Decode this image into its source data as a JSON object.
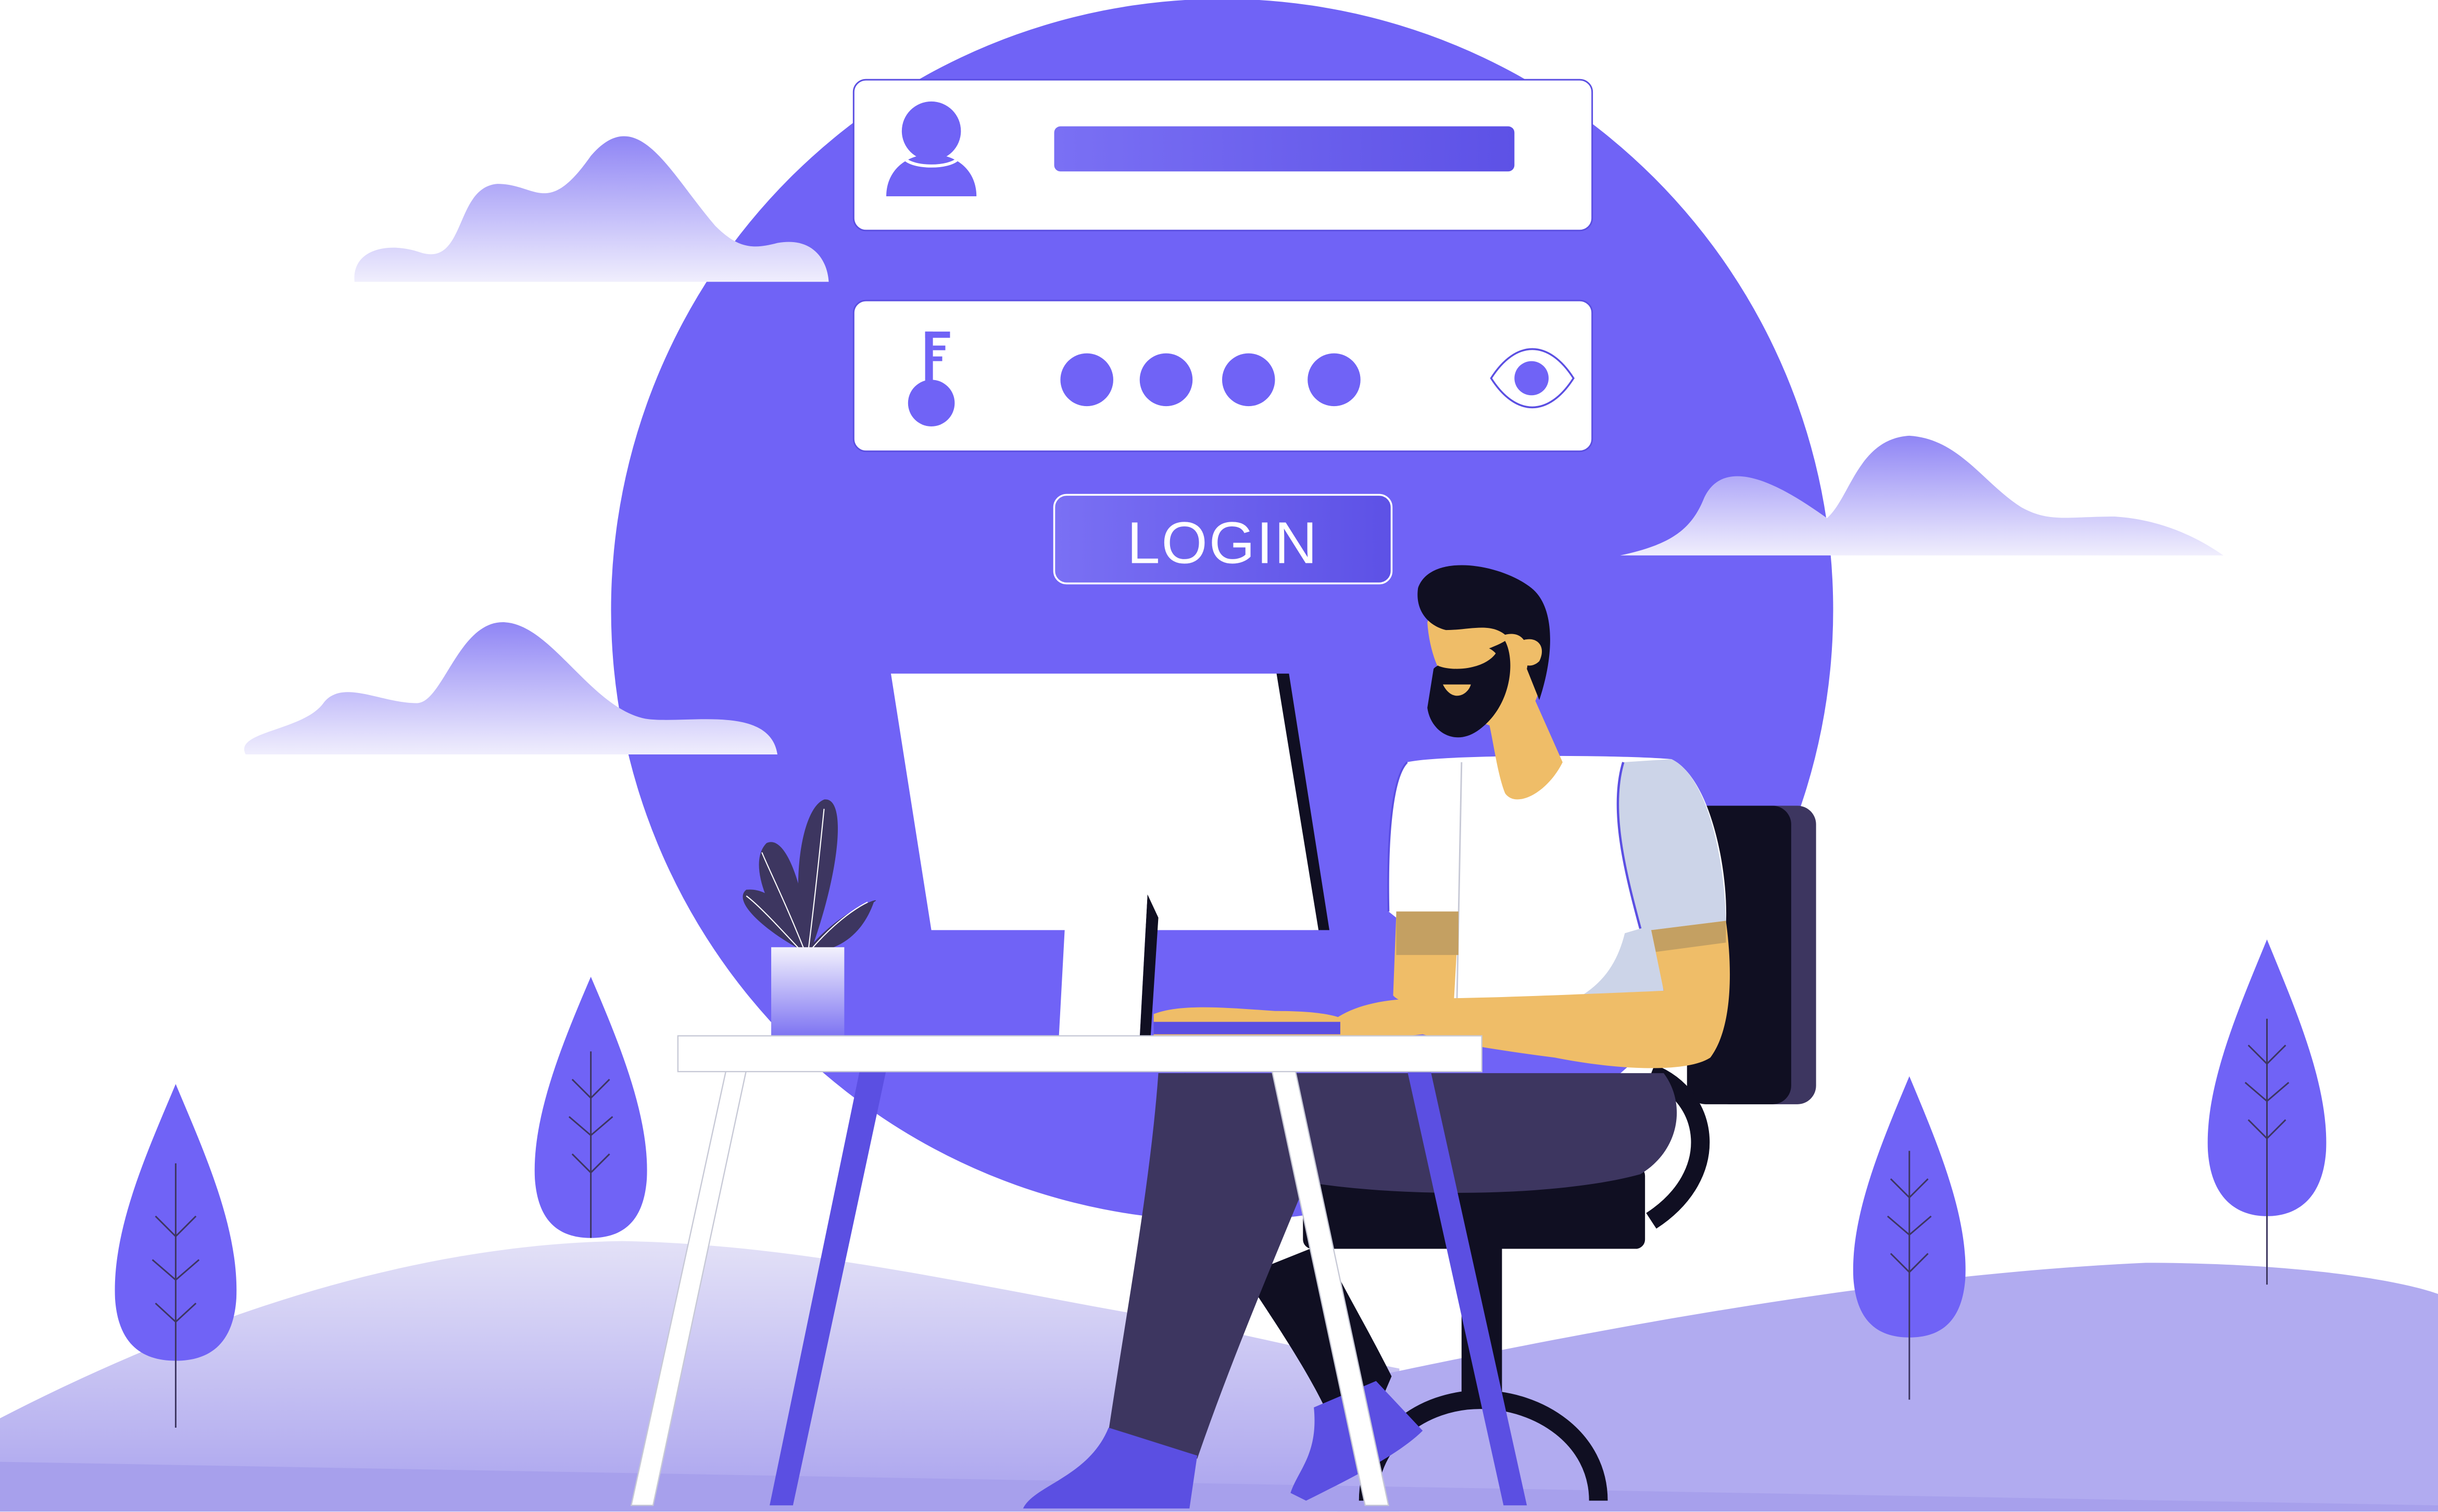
{
  "login_button": {
    "label": "LOGIN"
  },
  "password_field": {
    "masked_dot_count": 4
  },
  "colors": {
    "primary": "#7063f6",
    "primary_dark": "#5b4fe2",
    "primary_light": "#b3aef0",
    "dark_purple": "#3d3660",
    "ink": "#100f22",
    "skin": "#efbd68",
    "white": "#ffffff"
  },
  "icons": {
    "username": "user-icon",
    "password": "key-icon",
    "visibility": "eye-icon"
  }
}
